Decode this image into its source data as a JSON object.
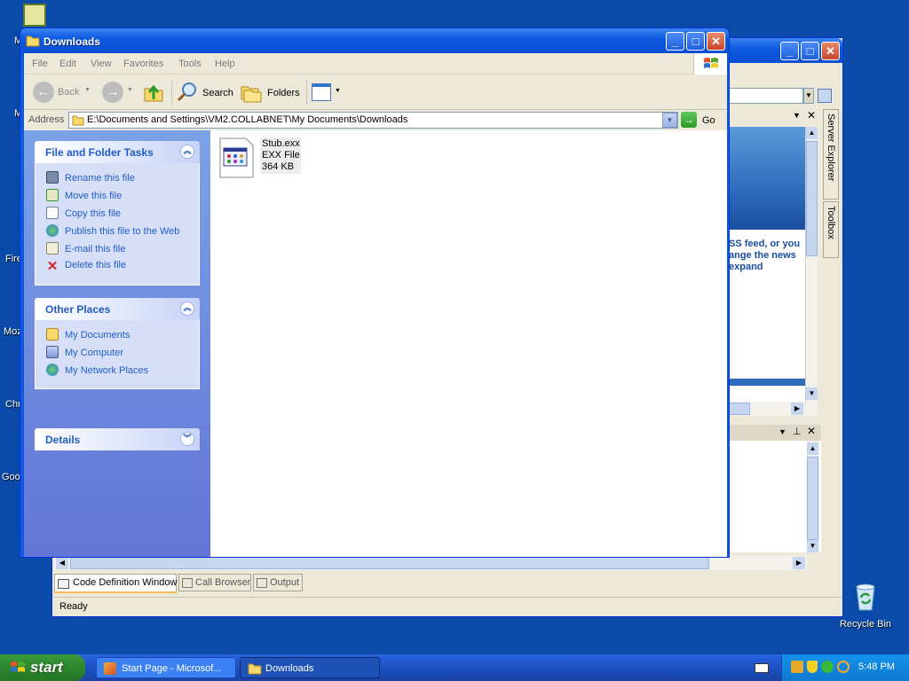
{
  "desktop": {
    "icons": [
      {
        "label": "M",
        "name": "desktop-icon-1"
      },
      {
        "label": "M",
        "name": "desktop-icon-2"
      },
      {
        "label": "Fire",
        "name": "desktop-icon-firefox"
      },
      {
        "label": "Moz",
        "name": "desktop-icon-mozilla"
      },
      {
        "label": "Chr",
        "name": "desktop-icon-chrome"
      },
      {
        "label": "Goo",
        "name": "desktop-icon-google"
      }
    ],
    "recycle_bin": "Recycle Bin"
  },
  "vs": {
    "rss_text": [
      "SS feed, or you",
      "ange the news",
      "expand"
    ],
    "server_explorer": "Server Explorer",
    "toolbox": "Toolbox",
    "tabs": [
      "Code Definition Window",
      "Call Browser",
      "Output"
    ],
    "status": "Ready"
  },
  "explorer": {
    "title": "Downloads",
    "menu": [
      "File",
      "Edit",
      "View",
      "Favorites",
      "Tools",
      "Help"
    ],
    "toolbar": {
      "back": "Back",
      "search": "Search",
      "folders": "Folders"
    },
    "address_label": "Address",
    "address": "E:\\Documents and Settings\\VM2.COLLABNET\\My Documents\\Downloads",
    "go": "Go",
    "file_tasks": {
      "title": "File and Folder Tasks",
      "items": [
        "Rename this file",
        "Move this file",
        "Copy this file",
        "Publish this file to the Web",
        "E-mail this file",
        "Delete this file"
      ]
    },
    "other_places": {
      "title": "Other Places",
      "items": [
        "My Documents",
        "My Computer",
        "My Network Places"
      ]
    },
    "details": {
      "title": "Details"
    },
    "file": {
      "name": "Stub.exx",
      "type": "EXX File",
      "size": "364 KB"
    }
  },
  "taskbar": {
    "start": "start",
    "tasks": [
      "Start Page - Microsof...",
      "Downloads"
    ],
    "clock": "5:48 PM"
  },
  "colors": {
    "desktop": "#0a4aa8",
    "taskbar": "#245edb",
    "start": "#2f8a2f",
    "link": "#215dc6"
  }
}
